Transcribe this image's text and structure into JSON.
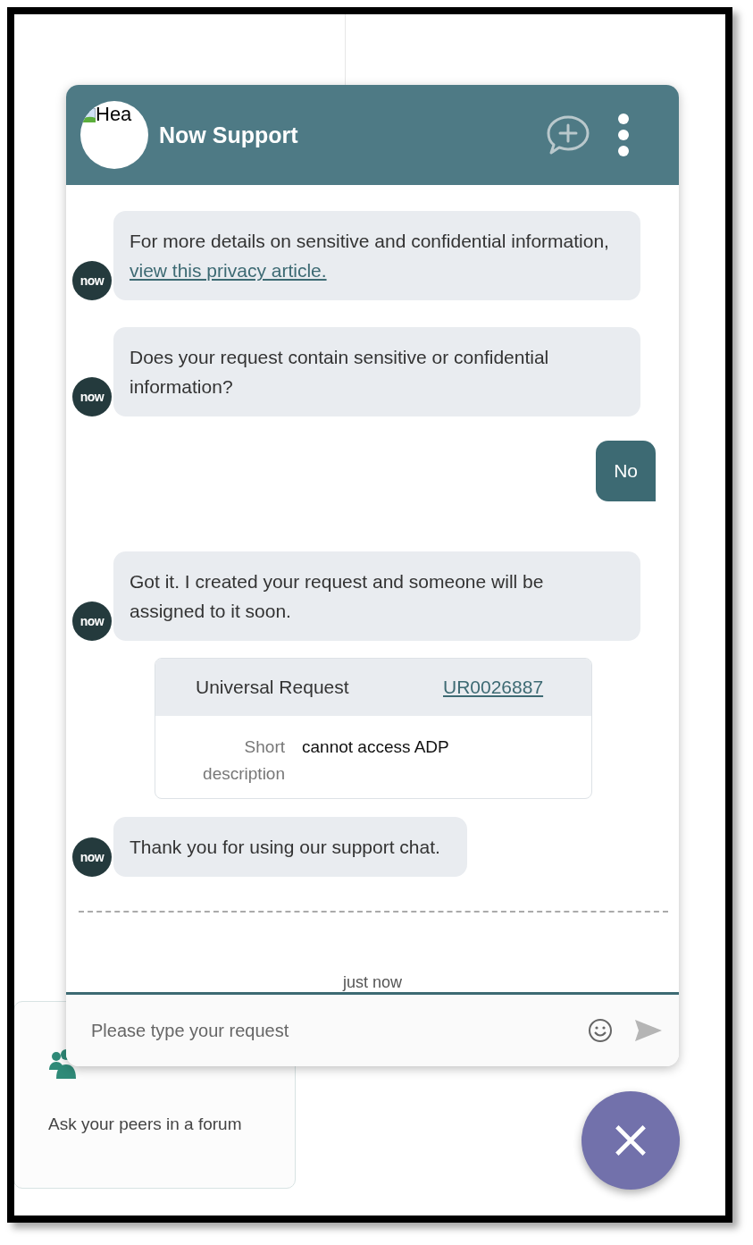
{
  "header": {
    "avatar_alt": "Hea",
    "title": "Now Support"
  },
  "messages": [
    {
      "kind": "bot",
      "avatar": "now",
      "text": "For more details on sensitive and confidential information, ",
      "link": "view this privacy article."
    },
    {
      "kind": "bot",
      "avatar": "now",
      "text": "Does your request contain sensitive or confidential information?"
    },
    {
      "kind": "user",
      "text": "No"
    },
    {
      "kind": "bot",
      "avatar": "now",
      "text": "Got it. I created your request and someone will be assigned to it soon."
    },
    {
      "kind": "card",
      "title": "Universal Request",
      "number": "UR0026887",
      "field_label": "Short description",
      "field_value": "cannot access ADP"
    },
    {
      "kind": "bot",
      "avatar": "now",
      "text": "Thank you for using our support chat."
    }
  ],
  "timestamp": "just now",
  "input": {
    "placeholder": "Please type your request"
  },
  "background_card": {
    "subtitle": "Ask your peers in a forum"
  }
}
